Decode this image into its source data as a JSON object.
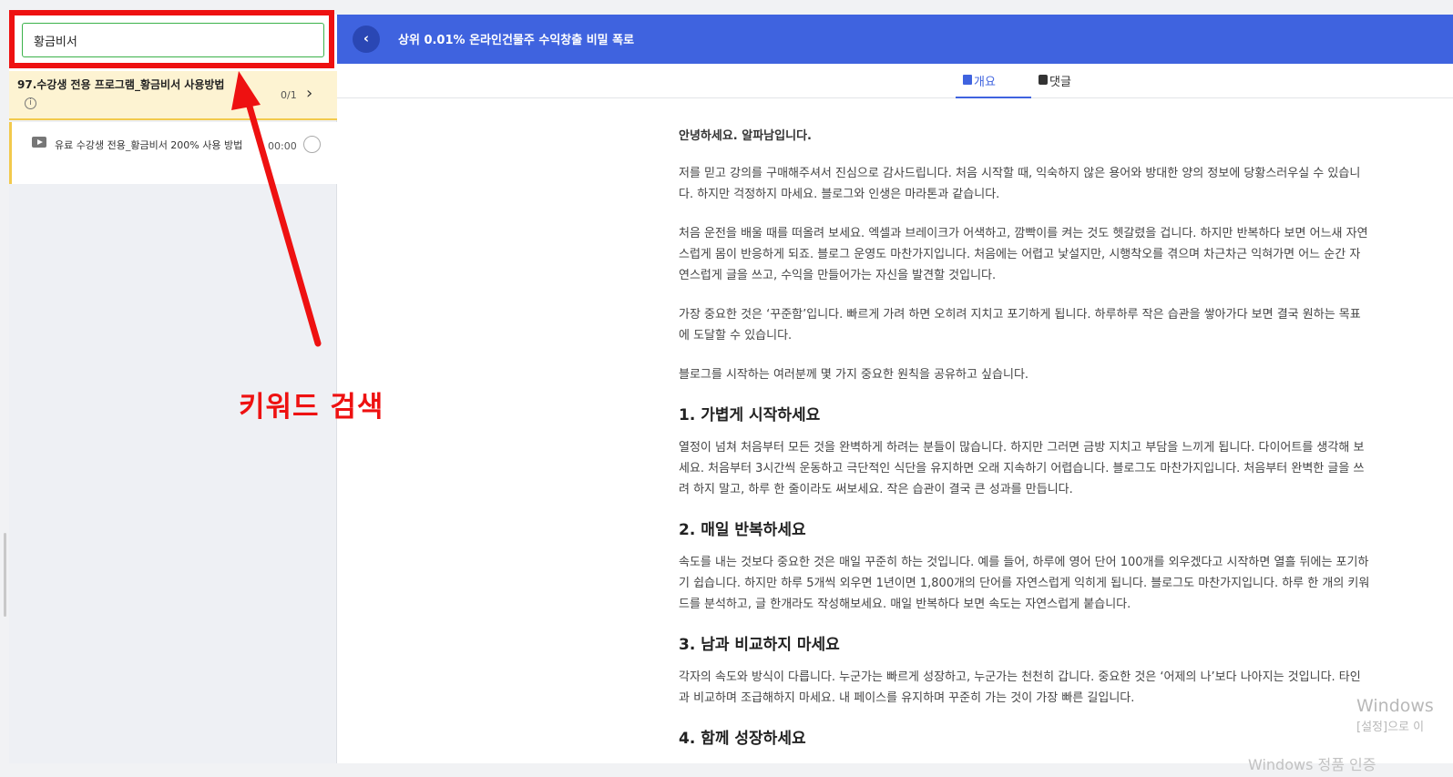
{
  "search": {
    "value": "황금비서"
  },
  "sidebar": {
    "section": {
      "title": "97.수강생 전용 프로그램_황금비서 사용방법",
      "count": "0/1"
    },
    "lesson": {
      "title": "유료 수강생 전용_황금비서 200% 사용 방법",
      "time": "00:00"
    }
  },
  "header": {
    "title": "상위 0.01% 온라인건물주 수익창출 비밀 폭로"
  },
  "tabs": [
    {
      "label": "개요"
    },
    {
      "label": "댓글"
    }
  ],
  "content": {
    "greeting": "안녕하세요. 알파남입니다.",
    "p1": "저를 믿고 강의를 구매해주셔서 진심으로 감사드립니다. 처음 시작할 때, 익숙하지 않은 용어와 방대한 양의 정보에 당황스러우실 수 있습니다. 하지만 걱정하지 마세요. 블로그와 인생은 마라톤과 같습니다.",
    "p2": "처음 운전을 배울 때를 떠올려 보세요. 엑셀과 브레이크가 어색하고, 깜빡이를 켜는 것도 헷갈렸을 겁니다. 하지만 반복하다 보면 어느새 자연스럽게 몸이 반응하게 되죠. 블로그 운영도 마찬가지입니다. 처음에는 어렵고 낯설지만, 시행착오를 겪으며 차근차근 익혀가면 어느 순간 자연스럽게 글을 쓰고, 수익을 만들어가는 자신을 발견할 것입니다.",
    "p3": "가장 중요한 것은 ‘꾸준함’입니다. 빠르게 가려 하면 오히려 지치고 포기하게 됩니다. 하루하루 작은 습관을 쌓아가다 보면 결국 원하는 목표에 도달할 수 있습니다.",
    "p4": "블로그를 시작하는 여러분께 몇 가지 중요한 원칙을 공유하고 싶습니다.",
    "h1": "1. 가볍게 시작하세요",
    "p5": "열정이 넘쳐 처음부터 모든 것을 완벽하게 하려는 분들이 많습니다. 하지만 그러면 금방 지치고 부담을 느끼게 됩니다. 다이어트를 생각해 보세요. 처음부터 3시간씩 운동하고 극단적인 식단을 유지하면 오래 지속하기 어렵습니다. 블로그도 마찬가지입니다. 처음부터 완벽한 글을 쓰려 하지 말고, 하루 한 줄이라도 써보세요. 작은 습관이 결국 큰 성과를 만듭니다.",
    "h2": "2. 매일 반복하세요",
    "p6": "속도를 내는 것보다 중요한 것은 매일 꾸준히 하는 것입니다. 예를 들어, 하루에 영어 단어 100개를 외우겠다고 시작하면 열흘 뒤에는 포기하기 쉽습니다. 하지만 하루 5개씩 외우면 1년이면 1,800개의 단어를 자연스럽게 익히게 됩니다. 블로그도 마찬가지입니다. 하루 한 개의 키워드를 분석하고, 글 한개라도 작성해보세요. 매일 반복하다 보면 속도는 자연스럽게 붙습니다.",
    "h3": "3. 남과 비교하지 마세요",
    "p7": "각자의 속도와 방식이 다릅니다. 누군가는 빠르게 성장하고, 누군가는 천천히 갑니다. 중요한 것은 ‘어제의 나’보다 나아지는 것입니다. 타인과 비교하며 조급해하지 마세요. 내 페이스를 유지하며 꾸준히 가는 것이 가장 빠른 길입니다.",
    "h4": "4. 함께 성장하세요"
  },
  "annotation": {
    "label": "키워드 검색",
    "color": "#ee1111"
  },
  "watermark": {
    "line1": "Windows",
    "line2": "[설정]으로 이",
    "line3": "Windows 정품 인증"
  },
  "colors": {
    "primary": "#3f63df",
    "accent_yellow": "#f2c94c",
    "search_border": "#3bb24a"
  },
  "icons": [
    "info-icon",
    "chevron-right-icon",
    "play-icon",
    "chevron-left-icon",
    "document-icon",
    "chat-icon"
  ]
}
